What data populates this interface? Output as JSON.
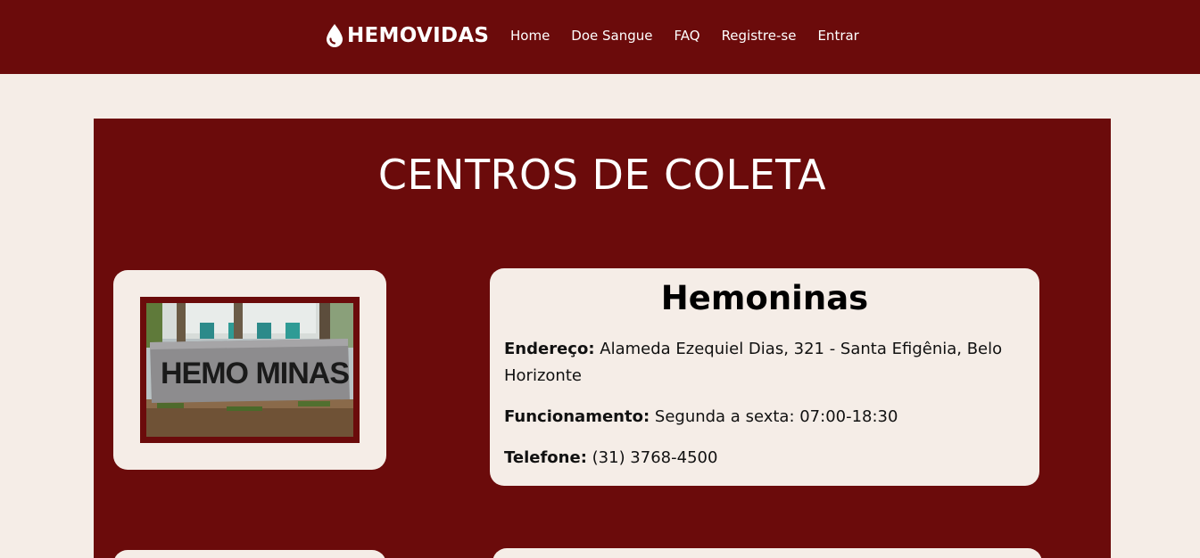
{
  "header": {
    "brand": "HEMOVIDAS",
    "brand_icon": "blood-drop-icon",
    "nav": [
      "Home",
      "Doe Sangue",
      "FAQ",
      "Registre-se",
      "Entrar"
    ]
  },
  "main": {
    "title": "CENTROS DE COLETA",
    "centers": [
      {
        "name": "Hemoninas",
        "photo_sign": "HEMO MINAS",
        "address_label": "Endereço:",
        "address": "Alameda Ezequiel Dias, 321 - Santa Efigênia, Belo Horizonte",
        "hours_label": "Funcionamento:",
        "hours": "Segunda a sexta: 07:00-18:30",
        "phone_label": "Telefone:",
        "phone": "(31) 3768-4500"
      }
    ]
  },
  "colors": {
    "primary": "#6b0b0b",
    "background": "#f5ede7",
    "text_light": "#ffffff",
    "text_dark": "#000000"
  }
}
